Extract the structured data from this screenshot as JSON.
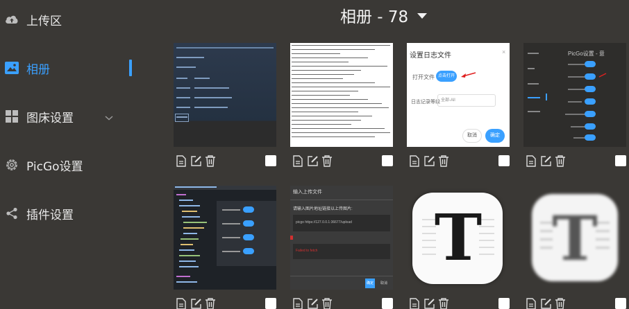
{
  "sidebar": {
    "items": [
      {
        "label": "上传区",
        "icon": "cloud-upload-icon"
      },
      {
        "label": "相册",
        "icon": "gallery-icon"
      },
      {
        "label": "图床设置",
        "icon": "grid-icon"
      },
      {
        "label": "PicGo设置",
        "icon": "gear-icon"
      },
      {
        "label": "插件设置",
        "icon": "share-icon"
      }
    ]
  },
  "header": {
    "title": "相册 - 78"
  },
  "colors": {
    "accent": "#3aa0ff",
    "background": "#3a3835"
  },
  "thumbs": {
    "t3": {
      "dialog_title": "设置日志文件",
      "row1_label": "打开文件",
      "row1_button": "点击打开",
      "row2_label": "日志记录等级",
      "row2_value": "全部-All",
      "cancel": "取消",
      "ok": "确定"
    },
    "t4": {
      "title": "PicGo设置 - 意"
    },
    "t6": {
      "title": "输入上传文件",
      "subtitle": "请输入图片地址链接以上传图片:",
      "line1": "picgo https://127.0.0.1:36677/upload",
      "error": "Failed to fetch",
      "ok": "确定",
      "cancel": "取消"
    },
    "t7": {
      "glyph": "T"
    },
    "t8": {
      "glyph": "T"
    }
  }
}
